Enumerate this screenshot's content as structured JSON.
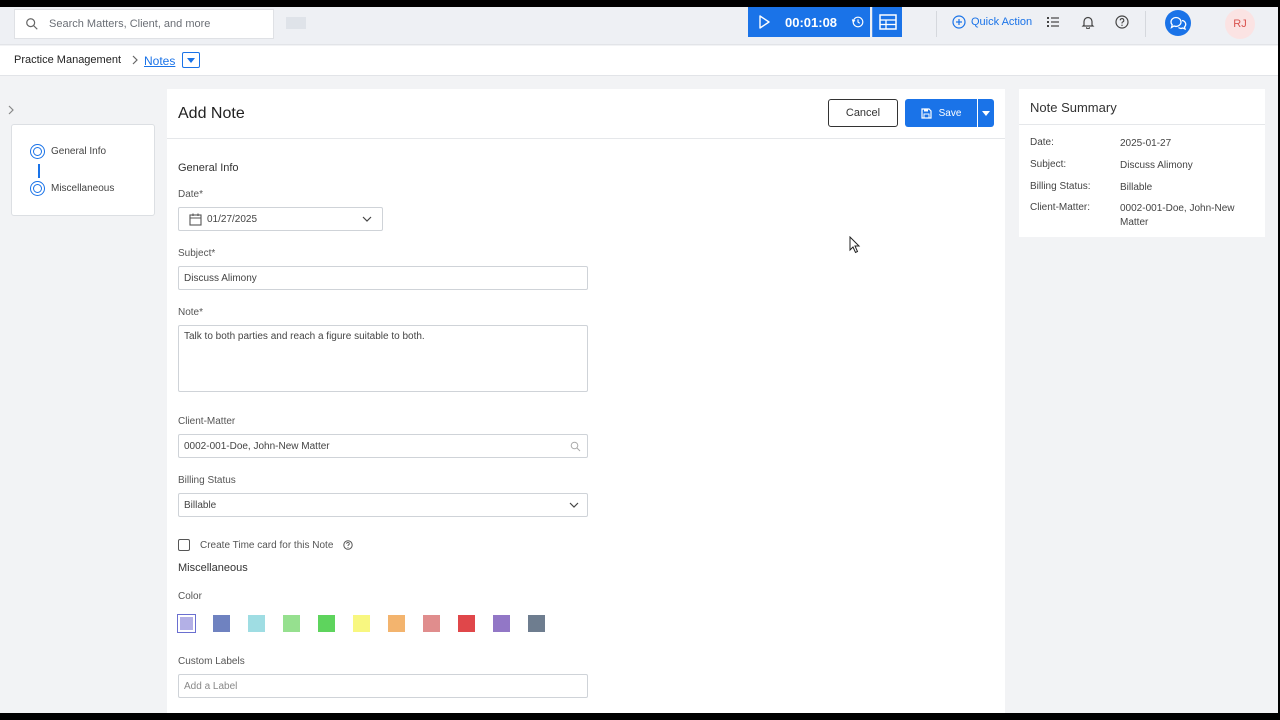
{
  "topbar": {
    "search_placeholder": "Search Matters, Client, and more",
    "timer": "00:01:08",
    "quick_action": "Quick Action",
    "avatar_initials": "RJ",
    "accent": "#1a73e8"
  },
  "breadcrumb": {
    "root": "Practice Management",
    "current": "Notes"
  },
  "stepper": {
    "items": [
      "General Info",
      "Miscellaneous"
    ]
  },
  "form": {
    "title": "Add Note",
    "cancel_label": "Cancel",
    "save_label": "Save",
    "general_info_title": "General Info",
    "date_label": "Date*",
    "date_value": "01/27/2025",
    "subject_label": "Subject*",
    "subject_value": "Discuss Alimony",
    "note_label": "Note*",
    "note_value": "Talk to both parties and reach a figure suitable to both.",
    "client_matter_label": "Client-Matter",
    "client_matter_value": "0002-001-Doe, John-New Matter",
    "billing_status_label": "Billing Status",
    "billing_status_value": "Billable",
    "timecard_label": "Create Time card for this Note",
    "misc_title": "Miscellaneous",
    "color_label": "Color",
    "colors": [
      "#b3b0e6",
      "#6f82c0",
      "#9fdde3",
      "#96e08f",
      "#5ed45d",
      "#f8f780",
      "#f3b46e",
      "#e08d8d",
      "#e0474a",
      "#9277c6",
      "#6e7d8f"
    ],
    "custom_labels_label": "Custom Labels",
    "custom_labels_placeholder": "Add a Label"
  },
  "summary": {
    "title": "Note Summary",
    "rows": [
      {
        "key": "Date:",
        "value": "2025-01-27"
      },
      {
        "key": "Subject:",
        "value": "Discuss Alimony"
      },
      {
        "key": "Billing Status:",
        "value": "Billable"
      },
      {
        "key": "Client-Matter:",
        "value": "0002-001-Doe, John-New Matter"
      }
    ]
  }
}
